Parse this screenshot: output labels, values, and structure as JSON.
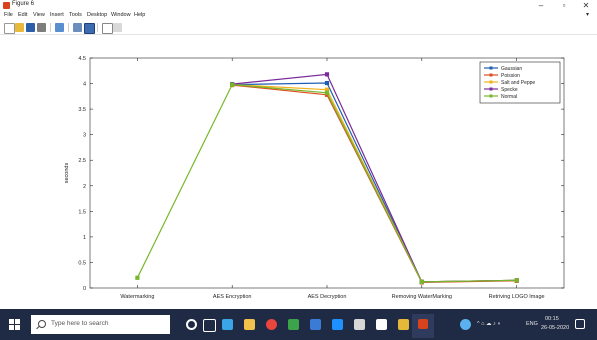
{
  "window": {
    "title": "Figure 6",
    "controls": {
      "minimize": "–",
      "maximize": "▫",
      "close": "✕"
    }
  },
  "menu": [
    "File",
    "Edit",
    "View",
    "Insert",
    "Tools",
    "Desktop",
    "Window",
    "Help"
  ],
  "chart_data": {
    "type": "line",
    "categories": [
      "Watermarking",
      "AES Encryption",
      "AES Decryption",
      "Removing WaterMarking",
      "Retriving LOGO Image"
    ],
    "ylabel": "seconds",
    "xlabel": "",
    "ylim": [
      0,
      4.5
    ],
    "yticks": [
      "0",
      "0.5",
      "1",
      "1.5",
      "2",
      "2.5",
      "3",
      "3.5",
      "4",
      "4.5"
    ],
    "legend_position": "top-right",
    "grid": false,
    "series": [
      {
        "name": "Gaussian",
        "color": "#1f5fb3",
        "values": [
          null,
          3.98,
          4.01,
          0.12,
          0.15
        ]
      },
      {
        "name": "Poission",
        "color": "#e24b1f",
        "values": [
          null,
          3.97,
          3.78,
          0.11,
          0.14
        ]
      },
      {
        "name": "Salt and Peppe",
        "color": "#f0b21a",
        "values": [
          null,
          3.98,
          3.88,
          0.12,
          0.15
        ]
      },
      {
        "name": "Specke",
        "color": "#7a2a9b",
        "values": [
          null,
          3.99,
          4.18,
          0.12,
          0.15
        ]
      },
      {
        "name": "Normal",
        "color": "#76b82a",
        "values": [
          0.2,
          3.98,
          3.82,
          0.12,
          0.15
        ]
      }
    ]
  },
  "taskbar": {
    "search_placeholder": "Type here to search",
    "tray_lang": "ENG",
    "time": "00:15",
    "date": "26-05-2020"
  }
}
